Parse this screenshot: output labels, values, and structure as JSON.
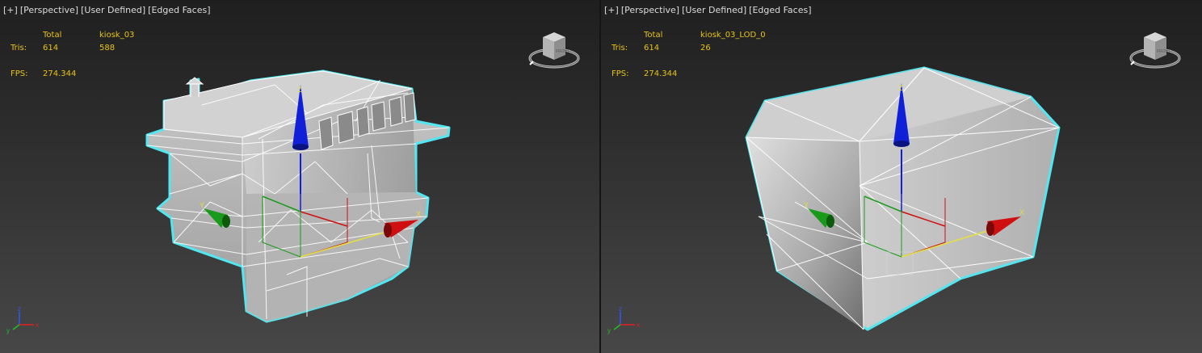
{
  "viewports": [
    {
      "labels": [
        "[+]",
        "[Perspective]",
        "[User Defined]",
        "[Edged Faces]"
      ],
      "stats": {
        "col_total": "Total",
        "col_object": "kiosk_03",
        "tris_label": "Tris:",
        "tris_total": "614",
        "tris_object": "588",
        "fps_label": "FPS:",
        "fps_value": "274.344"
      },
      "viewcube": {
        "front": "FRONT"
      },
      "axis_tripod": {
        "x": "x",
        "y": "y",
        "z": "z"
      },
      "gizmo_axes": {
        "x": "X",
        "y": "Y",
        "z": "Z"
      }
    },
    {
      "labels": [
        "[+]",
        "[Perspective]",
        "[User Defined]",
        "[Edged Faces]"
      ],
      "stats": {
        "col_total": "Total",
        "col_object": "kiosk_03_LOD_0",
        "tris_label": "Tris:",
        "tris_total": "614",
        "tris_object": "26",
        "fps_label": "FPS:",
        "fps_value": "274.344"
      },
      "viewcube": {
        "front": "FRONT"
      },
      "axis_tripod": {
        "x": "x",
        "y": "y",
        "z": "z"
      },
      "gizmo_axes": {
        "x": "X",
        "y": "Y",
        "z": "Z"
      }
    }
  ],
  "colors": {
    "stats_text": "#e8c21a",
    "label_text": "#dcdcdc",
    "selection_outline": "#52e6f0",
    "gizmo_x": "#d01010",
    "gizmo_y": "#1a9a1a",
    "gizmo_z": "#1020d8",
    "mesh_fill": "#b8b8b8"
  }
}
